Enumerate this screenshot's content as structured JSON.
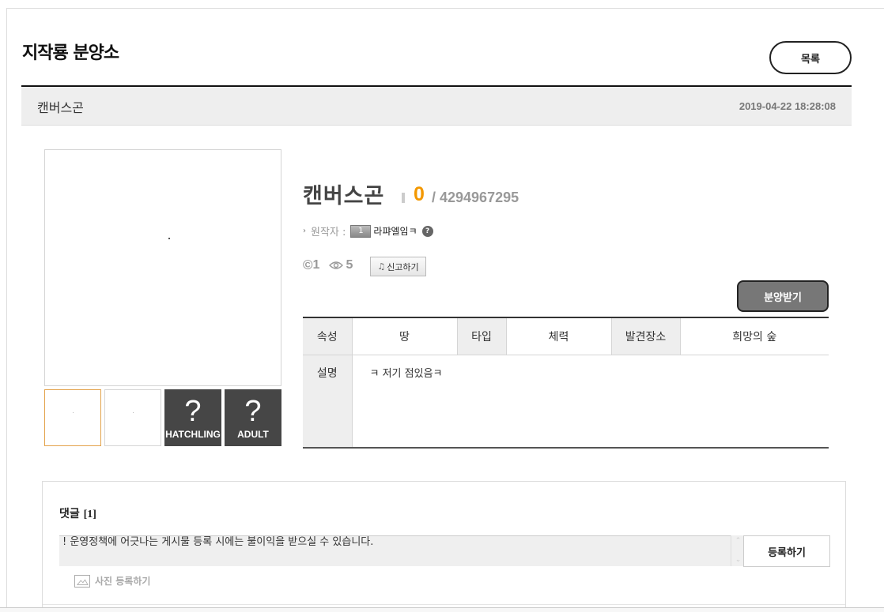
{
  "header": {
    "page_title": "지작룡 분양소",
    "list_button": "목록"
  },
  "post": {
    "title": "캔버스곤",
    "date": "2019-04-22 18:28:08"
  },
  "thumbnails": [
    {
      "label": ""
    },
    {
      "label": ""
    },
    {
      "symbol": "?",
      "label": "HATCHLING"
    },
    {
      "symbol": "?",
      "label": "ADULT"
    }
  ],
  "creature": {
    "name": "캔버스곤",
    "count": "0",
    "max": "/ 4294967295",
    "author_label": "원작자 :",
    "author_level": "1",
    "author_name": "라퍄엘임ㅋ",
    "help": "?",
    "copyright_symbol": "©",
    "copy_count": "1",
    "view_count": "5",
    "report_label": "신고하기",
    "adopt_label": "분양받기"
  },
  "info_table": {
    "attr_label": "속성",
    "attr_value": "땅",
    "type_label": "타입",
    "type_value": "체력",
    "place_label": "발견장소",
    "place_value": "희망의 숲",
    "desc_label": "설명",
    "desc_value": "ㅋ 저기 점있음ㅋ"
  },
  "comments": {
    "title": "댓글",
    "count": "[1]",
    "notice": "! 운영정책에 어긋나는 게시물 등록 시에는 불이익을 받으실 수 있습니다.",
    "submit_label": "등록하기",
    "photo_label": "사진 등록하기"
  },
  "colors": {
    "accent_orange": "#f39800",
    "thumb_dark": "#464646",
    "adopt_button": "#777777"
  }
}
